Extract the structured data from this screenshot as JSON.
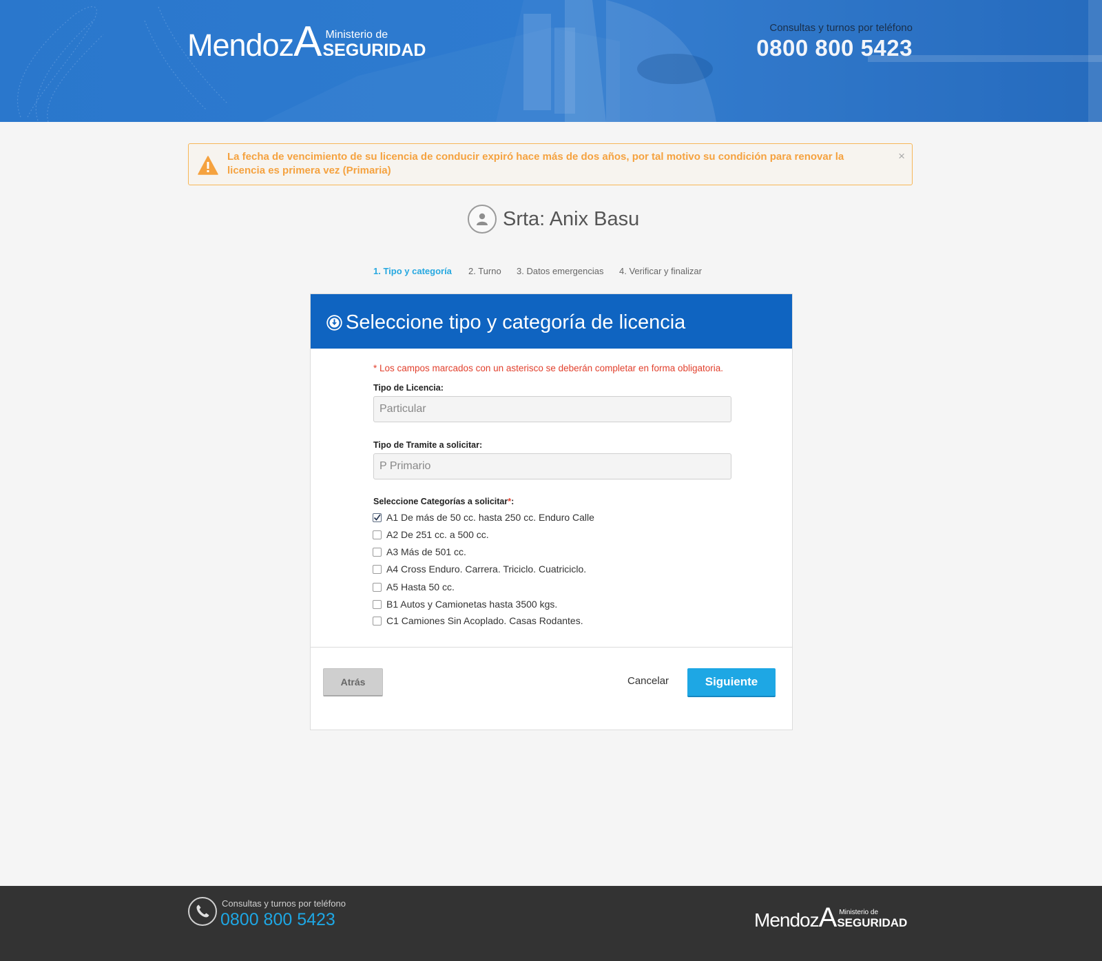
{
  "header": {
    "logo": {
      "mendoza": "Mendoz",
      "a": "A",
      "ministerio": "Ministerio de",
      "seguridad": "SEGURIDAD"
    },
    "phone_label": "Consultas y turnos por teléfono",
    "phone_number": "0800 800 5423"
  },
  "alert": {
    "icon": "warning-icon",
    "message": "La fecha de vencimiento de su licencia de conducir expiró hace más de dos años, por tal motivo su condición para renovar la licencia es primera vez (Primaria)",
    "close": "×",
    "color": "#f5a23f"
  },
  "user": {
    "icon": "user-icon",
    "name": "Srta: Anix Basu"
  },
  "steps": [
    {
      "label": "1. Tipo y categoría",
      "active": true
    },
    {
      "label": "2. Turno",
      "active": false
    },
    {
      "label": "3. Datos emergencias",
      "active": false
    },
    {
      "label": "4. Verificar y finalizar",
      "active": false
    }
  ],
  "form": {
    "title": "Seleccione tipo y categoría de licencia",
    "required_note": "* Los campos marcados con un asterisco se deberán completar en forma obligatoria.",
    "license_type_label": "Tipo de Licencia:",
    "license_type_value": "Particular",
    "procedure_label": "Tipo de Tramite a solicitar:",
    "procedure_value": "P Primario",
    "categories_label": "Seleccione Categorías a solicitar",
    "categories_star": "*",
    "categories_colon": ":",
    "categories": [
      {
        "label": "A1 De más de 50 cc. hasta 250 cc. Enduro Calle",
        "checked": true
      },
      {
        "label": "A2 De 251 cc. a 500 cc.",
        "checked": false
      },
      {
        "label": "A3 Más de 501 cc.",
        "checked": false
      },
      {
        "label": "A4 Cross Enduro. Carrera. Triciclo. Cuatriciclo.",
        "checked": false
      },
      {
        "label": "A5 Hasta 50 cc.",
        "checked": false
      },
      {
        "label": "B1 Autos y Camionetas hasta 3500 kgs.",
        "checked": false
      },
      {
        "label": "C1 Camiones Sin Acoplado. Casas Rodantes.",
        "checked": false
      }
    ],
    "back_label": "Atrás",
    "cancel_label": "Cancelar",
    "next_label": "Siguiente"
  },
  "footer": {
    "phone_label": "Consultas y turnos por teléfono",
    "phone_number": "0800 800 5423",
    "logo": {
      "mendoza": "Mendoz",
      "a": "A",
      "ministerio": "Ministerio de",
      "seguridad": "SEGURIDAD"
    }
  },
  "colors": {
    "header_bg": "#1f6fc6",
    "card_head_bg": "#0f64c1",
    "accent": "#1ea7e4",
    "alert": "#f5a23f",
    "required": "#e2402d",
    "footer_bg": "#333333"
  }
}
